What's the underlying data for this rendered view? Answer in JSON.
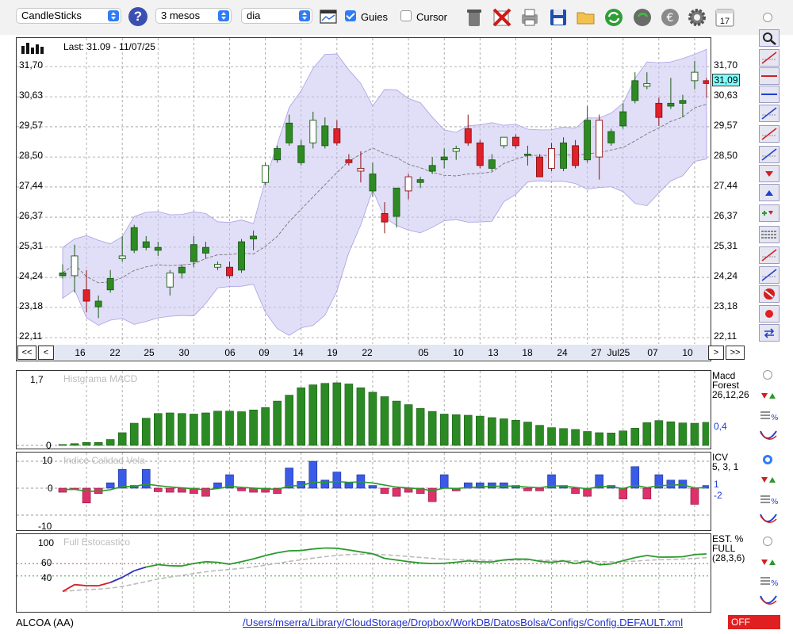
{
  "toolbar": {
    "chart_type": "CandleSticks",
    "period": "3 mesos",
    "interval": "dia",
    "guides_label": "Guies",
    "guides_checked": true,
    "cursor_label": "Cursor",
    "cursor_checked": false,
    "icons": [
      "help-icon",
      "chart-window-icon",
      "trash-icon",
      "delete-icon",
      "print-icon",
      "save-icon",
      "folder-icon",
      "refresh-icon",
      "download-icon",
      "euro-icon",
      "settings-icon",
      "calendar-icon"
    ],
    "calendar_day": "17"
  },
  "main_chart": {
    "last_label": "Last: 31.09 - 11/07/25",
    "price_badge": "31,09",
    "y_ticks": [
      "31,70",
      "30,63",
      "29,57",
      "28,50",
      "27,44",
      "26,37",
      "25,31",
      "24,24",
      "23,18",
      "22,11"
    ],
    "x_ticks": [
      "16",
      "22",
      "25",
      "30",
      "06",
      "09",
      "14",
      "19",
      "22",
      "05",
      "10",
      "13",
      "18",
      "24",
      "27",
      "Jul25",
      "07",
      "10"
    ],
    "nav_left": [
      "<<",
      "<"
    ],
    "nav_right": [
      ">",
      ">>"
    ],
    "colors": {
      "up": "#2e8b22",
      "down": "#e0202a",
      "band": "#c9c2f0"
    }
  },
  "macd": {
    "title": "Histgrama MACD",
    "y_top": "1,7",
    "y_zero": "0",
    "legend_lines": [
      "Macd",
      "Forest",
      "26,12,26"
    ],
    "value": "0,4"
  },
  "icv": {
    "title": "Indice Calidad Vela",
    "y_ticks": [
      "10",
      "0",
      "-10"
    ],
    "legend_lines": [
      "ICV",
      "5, 3, 1"
    ],
    "values": [
      "1",
      "-2"
    ]
  },
  "stoch": {
    "title": "Full Estocastico",
    "y_ticks": [
      "100",
      "60",
      "40"
    ],
    "legend_lines": [
      "EST. %",
      "FULL",
      "(28,3,6)"
    ]
  },
  "status": {
    "symbol": "ALCOA (AA)",
    "path": "/Users/mserra/Library/CloudStorage/Dropbox/WorkDB/DatosBolsa/Configs/Config.DEFAULT.xml",
    "off_label": "OFF"
  },
  "chart_data": {
    "type": "candlestick",
    "ylim": [
      22.11,
      32.76
    ],
    "candles": [
      {
        "o": 24.3,
        "h": 24.7,
        "l": 24.2,
        "c": 24.4
      },
      {
        "o": 24.3,
        "h": 25.4,
        "l": 23.7,
        "c": 25.0
      },
      {
        "o": 23.8,
        "h": 24.5,
        "l": 23.0,
        "c": 23.4
      },
      {
        "o": 23.2,
        "h": 23.6,
        "l": 22.8,
        "c": 23.4
      },
      {
        "o": 23.8,
        "h": 24.5,
        "l": 23.7,
        "c": 24.2
      },
      {
        "o": 24.9,
        "h": 25.7,
        "l": 24.8,
        "c": 25.0
      },
      {
        "o": 25.2,
        "h": 26.1,
        "l": 25.1,
        "c": 26.0
      },
      {
        "o": 25.3,
        "h": 25.7,
        "l": 25.2,
        "c": 25.5
      },
      {
        "o": 25.2,
        "h": 25.5,
        "l": 25.0,
        "c": 25.3
      },
      {
        "o": 23.9,
        "h": 24.5,
        "l": 23.6,
        "c": 24.4
      },
      {
        "o": 24.4,
        "h": 24.7,
        "l": 24.2,
        "c": 24.6
      },
      {
        "o": 24.8,
        "h": 25.7,
        "l": 24.6,
        "c": 25.4
      },
      {
        "o": 25.1,
        "h": 25.5,
        "l": 24.9,
        "c": 25.3
      },
      {
        "o": 24.6,
        "h": 24.8,
        "l": 24.5,
        "c": 24.7
      },
      {
        "o": 24.6,
        "h": 24.8,
        "l": 24.2,
        "c": 24.3
      },
      {
        "o": 24.5,
        "h": 25.6,
        "l": 24.4,
        "c": 25.5
      },
      {
        "o": 25.6,
        "h": 25.9,
        "l": 25.2,
        "c": 25.7
      },
      {
        "o": 27.6,
        "h": 28.3,
        "l": 27.5,
        "c": 28.2
      },
      {
        "o": 28.4,
        "h": 28.9,
        "l": 28.3,
        "c": 28.8
      },
      {
        "o": 29.0,
        "h": 30.0,
        "l": 28.9,
        "c": 29.7
      },
      {
        "o": 28.3,
        "h": 29.1,
        "l": 28.2,
        "c": 28.9
      },
      {
        "o": 29.0,
        "h": 30.1,
        "l": 28.8,
        "c": 29.8
      },
      {
        "o": 28.9,
        "h": 29.9,
        "l": 28.8,
        "c": 29.6
      },
      {
        "o": 29.5,
        "h": 29.8,
        "l": 28.9,
        "c": 29.0
      },
      {
        "o": 28.4,
        "h": 28.6,
        "l": 28.2,
        "c": 28.3
      },
      {
        "o": 28.1,
        "h": 28.7,
        "l": 27.6,
        "c": 28.0
      },
      {
        "o": 27.3,
        "h": 28.3,
        "l": 27.1,
        "c": 27.9
      },
      {
        "o": 26.5,
        "h": 26.9,
        "l": 25.8,
        "c": 26.2
      },
      {
        "o": 26.4,
        "h": 27.2,
        "l": 26.0,
        "c": 27.4
      },
      {
        "o": 27.8,
        "h": 27.9,
        "l": 27.0,
        "c": 27.3
      },
      {
        "o": 27.6,
        "h": 27.8,
        "l": 27.4,
        "c": 27.7
      },
      {
        "o": 28.0,
        "h": 28.5,
        "l": 27.9,
        "c": 28.2
      },
      {
        "o": 28.4,
        "h": 28.8,
        "l": 28.1,
        "c": 28.5
      },
      {
        "o": 28.7,
        "h": 28.9,
        "l": 28.4,
        "c": 28.8
      },
      {
        "o": 29.5,
        "h": 30.0,
        "l": 28.9,
        "c": 29.0
      },
      {
        "o": 29.0,
        "h": 29.1,
        "l": 28.1,
        "c": 28.2
      },
      {
        "o": 28.1,
        "h": 28.6,
        "l": 28.0,
        "c": 28.4
      },
      {
        "o": 28.9,
        "h": 29.2,
        "l": 28.8,
        "c": 29.2
      },
      {
        "o": 29.2,
        "h": 29.3,
        "l": 28.8,
        "c": 28.9
      },
      {
        "o": 28.6,
        "h": 28.9,
        "l": 28.2,
        "c": 28.6
      },
      {
        "o": 28.5,
        "h": 28.6,
        "l": 27.8,
        "c": 27.8
      },
      {
        "o": 28.8,
        "h": 29.0,
        "l": 28.0,
        "c": 28.1
      },
      {
        "o": 28.1,
        "h": 29.2,
        "l": 28.0,
        "c": 29.0
      },
      {
        "o": 28.9,
        "h": 29.1,
        "l": 28.1,
        "c": 28.2
      },
      {
        "o": 28.4,
        "h": 30.3,
        "l": 28.3,
        "c": 29.8
      },
      {
        "o": 29.8,
        "h": 30.0,
        "l": 27.7,
        "c": 28.5
      },
      {
        "o": 29.0,
        "h": 29.5,
        "l": 28.9,
        "c": 29.4
      },
      {
        "o": 29.6,
        "h": 30.4,
        "l": 29.5,
        "c": 30.1
      },
      {
        "o": 30.5,
        "h": 31.5,
        "l": 30.4,
        "c": 31.2
      },
      {
        "o": 31.0,
        "h": 31.5,
        "l": 30.9,
        "c": 31.1
      },
      {
        "o": 30.4,
        "h": 30.6,
        "l": 29.6,
        "c": 29.9
      },
      {
        "o": 30.3,
        "h": 31.3,
        "l": 30.2,
        "c": 30.4
      },
      {
        "o": 30.4,
        "h": 30.7,
        "l": 29.9,
        "c": 30.5
      },
      {
        "o": 31.2,
        "h": 31.9,
        "l": 30.9,
        "c": 31.5
      },
      {
        "o": 31.2,
        "h": 31.3,
        "l": 30.6,
        "c": 31.1
      }
    ],
    "macd_hist": [
      0.03,
      0.06,
      0.1,
      0.1,
      0.2,
      0.43,
      0.75,
      0.92,
      1.08,
      1.1,
      1.08,
      1.06,
      1.1,
      1.16,
      1.16,
      1.14,
      1.2,
      1.28,
      1.5,
      1.7,
      1.95,
      2.05,
      2.1,
      2.12,
      2.08,
      1.95,
      1.8,
      1.65,
      1.5,
      1.38,
      1.25,
      1.15,
      1.06,
      1.04,
      1.02,
      0.99,
      0.94,
      0.9,
      0.85,
      0.79,
      0.68,
      0.6,
      0.57,
      0.54,
      0.47,
      0.43,
      0.42,
      0.49,
      0.58,
      0.77,
      0.84,
      0.8,
      0.76,
      0.75,
      0.78,
      0.74
    ],
    "icv": [
      -1.5,
      -0.5,
      -5.5,
      -2,
      2,
      7,
      1,
      7,
      -1.3,
      -1.5,
      -1.5,
      -2,
      -3,
      2,
      5,
      -1,
      -1.5,
      -1.5,
      -2,
      7.5,
      2.5,
      10,
      3,
      6,
      2,
      5,
      1,
      -2,
      -3,
      -1.5,
      -2,
      -5,
      5,
      -1,
      2,
      2,
      2,
      2,
      1,
      -1,
      -1,
      5,
      1,
      -2,
      -3,
      5,
      1,
      -4,
      8,
      -4,
      5,
      3,
      3,
      -6,
      1,
      3,
      4,
      -1,
      6,
      -1.5,
      -2
    ]
  }
}
